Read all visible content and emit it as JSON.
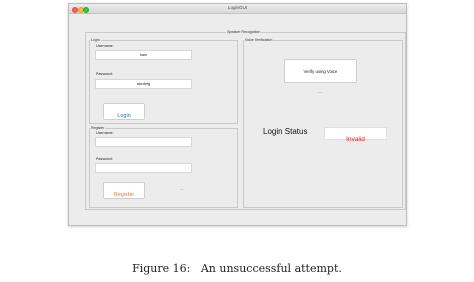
{
  "window": {
    "title": "LoginGUI"
  },
  "main_panel": {
    "title": "Speaker Recognition"
  },
  "login": {
    "title": "Login",
    "username_label": "Username:",
    "username_value": "ham",
    "password_label": "Password:",
    "password_value": "abcdefg",
    "button_label": "Login"
  },
  "register": {
    "title": "Register",
    "username_label": "Username:",
    "username_value": "",
    "password_label": "Password:",
    "password_value": "",
    "button_label": "Register",
    "ellipsis": "...."
  },
  "voice": {
    "title": "Voice Verification",
    "button_label": "Verify using Voice",
    "ellipsis": "....",
    "status_label": "Login Status",
    "status_value": "Invalid"
  },
  "colors": {
    "login_button_text": "#2b72c8",
    "register_button_text": "#e07a3a",
    "invalid_text": "#e02020"
  },
  "caption": {
    "label": "Figure 16:",
    "text": "An unsuccessful attempt."
  }
}
